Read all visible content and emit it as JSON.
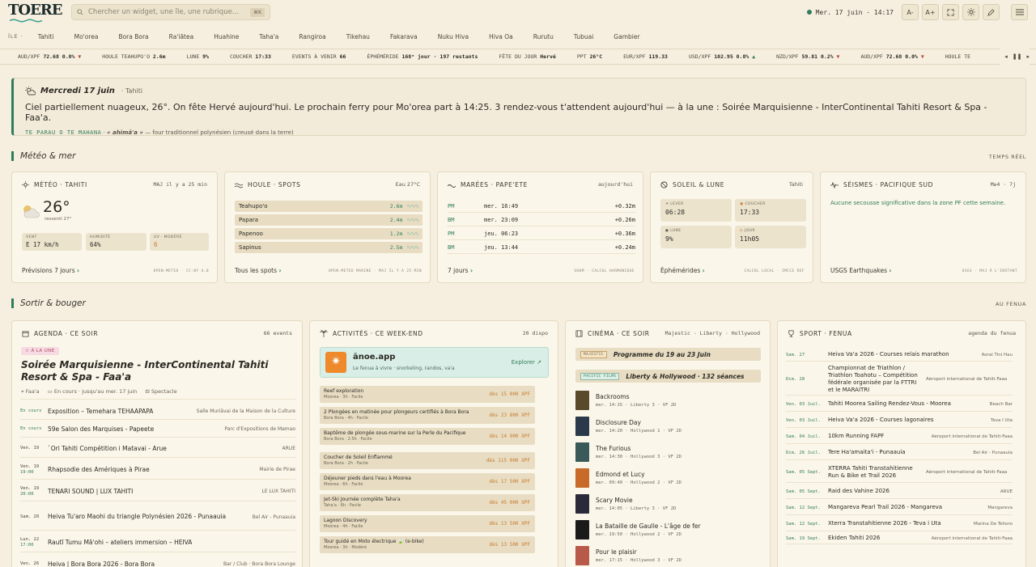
{
  "header": {
    "logo": "TOERE",
    "search_placeholder": "Chercher un widget, une île, une rubrique…",
    "search_kbd": "⌘K",
    "clock": "Mer. 17 juin · 14:17",
    "btn_font_down": "A-",
    "btn_font_up": "A+"
  },
  "islands": {
    "label": "ÎLE ·",
    "items": [
      "Tahiti",
      "Mo'orea",
      "Bora Bora",
      "Ra'iātea",
      "Huahine",
      "Taha'a",
      "Rangiroa",
      "Tikehau",
      "Fakarava",
      "Nuku Hiva",
      "Hiva Oa",
      "Rurutu",
      "Tubuai",
      "Gambier"
    ]
  },
  "ticker": [
    {
      "k": "AUD/XPF",
      "v": "72.68",
      "c": "0.0%",
      "dir": "down"
    },
    {
      "k": "HOULE TEAHUPO'O",
      "v": "2.6m"
    },
    {
      "k": "LUNE",
      "v": "9%"
    },
    {
      "k": "COUCHER",
      "v": "17:33"
    },
    {
      "k": "EVENTS À VENIR",
      "v": "66"
    },
    {
      "k": "ÉPHÉMÉRIDE",
      "v": "168ᵉ jour · 197 restants"
    },
    {
      "k": "FÊTE DU JOUR",
      "v": "Hervé"
    },
    {
      "k": "PPT",
      "v": "26°C"
    },
    {
      "k": "EUR/XPF",
      "v": "119.33"
    },
    {
      "k": "USD/XPF",
      "v": "102.95",
      "c": "0.8%",
      "dir": "up"
    },
    {
      "k": "NZD/XPF",
      "v": "59.81",
      "c": "0.2%",
      "dir": "down"
    },
    {
      "k": "AUD/XPF",
      "v": "72.68",
      "c": "0.0%",
      "dir": "down"
    },
    {
      "k": "HOULE TE",
      "v": ""
    }
  ],
  "hero": {
    "date": "Mercredi 17 juin",
    "loc": "Tahiti",
    "message": "Ciel partiellement nuageux, 26°. On fête Hervé aujourd'hui. Le prochain ferry pour Mo'orea part à 14:25. 3 rendez-vous t'attendent aujourd'hui — à la une : Soirée Marquisienne - InterContinental Tahiti Resort & Spa - Faa'a.",
    "sub_label": "TE PARAU O TE MAHANA",
    "sub_word": "« ahimā'a »",
    "sub_rest": "— four traditionnel polynésien (creusé dans la terre)"
  },
  "section1": {
    "title": "Météo & mer",
    "right": "TEMPS RÉEL"
  },
  "meteo": {
    "title": "MÉTÉO · TAHITI",
    "maj": "MAJ il y a 25 min",
    "temp": "26°",
    "ressenti": "ressenti 27°",
    "vent_l": "VENT",
    "vent_v": "E 17 km/h",
    "hum_l": "HUMIDITÉ",
    "hum_v": "64%",
    "uv_l": "UV · MODÉRÉ",
    "uv_v": "6",
    "foot": "Prévisions 7 jours",
    "src": "OPEN-METEO · CC-BY 4.0"
  },
  "houle": {
    "title": "HOULE · SPOTS",
    "eau": "Eau 27°C",
    "spots": [
      {
        "n": "Teahupo'o",
        "h": "2.6m"
      },
      {
        "n": "Papara",
        "h": "2.4m"
      },
      {
        "n": "Papenoo",
        "h": "1.2m"
      },
      {
        "n": "Sapinus",
        "h": "2.5m"
      }
    ],
    "foot": "Tous les spots",
    "src": "OPEN-METEO MARINE · MAJ IL Y A 25 MIN"
  },
  "marees": {
    "title": "MARÉES · PAPE'ETE",
    "right": "aujourd'hui",
    "rows": [
      {
        "k": "PM",
        "t": "mer. 16:49",
        "d": "+0.32m"
      },
      {
        "k": "BM",
        "t": "mer. 23:09",
        "d": "+0.26m"
      },
      {
        "k": "PM",
        "t": "jeu. 06:23",
        "d": "+0.36m"
      },
      {
        "k": "BM",
        "t": "jeu. 13:44",
        "d": "+0.24m"
      }
    ],
    "foot": "7 jours",
    "src": "SHOM · CALCUL HARMONIQUE"
  },
  "soleil": {
    "title": "SOLEIL & LUNE",
    "right": "Tahiti",
    "lever_l": "☀ LEVER",
    "lever_v": "06:28",
    "coucher_l": "COUCHER",
    "coucher_v": "17:33",
    "lune_l": "LUNE",
    "lune_v": "9%",
    "jour_l": "JOUR",
    "jour_v": "11h05",
    "foot": "Éphémérides",
    "src": "CALCUL LOCAL · IMCCE REF"
  },
  "seismes": {
    "title": "SÉISMES · PACIFIQUE SUD",
    "right": "M≥4 · 7j",
    "msg": "Aucune secousse significative dans la zone PF cette semaine.",
    "foot": "USGS Earthquakes",
    "src": "USGS · MAJ À L'INSTANT"
  },
  "section2": {
    "title": "Sortir & bouger",
    "right": "AU FENUA"
  },
  "agenda": {
    "title": "AGENDA · CE SOIR",
    "count": "66 events",
    "badge": "À LA UNE",
    "feat_title": "Soirée Marquisienne - InterContinental Tahiti Resort & Spa - Faa'a",
    "feat_loc": "Faa'a",
    "feat_when": "En cours · jusqu'au mer. 17 juin",
    "feat_type": "Spectacle",
    "rows": [
      {
        "d1": "En cours",
        "d2": "",
        "t": "Exposition – Temehara TEHAAPAPA",
        "p": "Salle Muriāvai de la Maison de la Culture",
        "enc": true
      },
      {
        "d1": "En cours",
        "d2": "",
        "t": "59e Salon des Marquises - Papeete",
        "p": "Parc d'Expositions de Mamao",
        "enc": true
      },
      {
        "d1": "Ven. 19",
        "d2": "",
        "t": "`Ori Tahiti Compétition i Matavai - Arue",
        "p": "ARUE"
      },
      {
        "d1": "Ven. 19",
        "d2": "19:00",
        "t": "Rhapsodie des Amériques à Pirae",
        "p": "Mairie de Pirae"
      },
      {
        "d1": "Ven. 19",
        "d2": "20:00",
        "t": "TENARI SOUND | LUX TAHITI",
        "p": "LE LUX TAHITI"
      },
      {
        "d1": "Sam. 20",
        "d2": "",
        "t": "Heiva Tu'aro Maohi du triangle Polynésien 2026 - Punaauia",
        "p": "Bel Air - Punaauia"
      },
      {
        "d1": "Lun. 22",
        "d2": "17:00",
        "t": "Rautī Tumu Mā'ohi – ateliers immersion – HEIVA",
        "p": ""
      },
      {
        "d1": "Ven. 26",
        "d2": "",
        "t": "Heiva | Bora Bora 2026 - Bora Bora",
        "p": "Bar / Club · Bora Bora Lounge"
      }
    ]
  },
  "activites": {
    "title": "ACTIVITÉS · CE WEEK-END",
    "count": "20 dispo",
    "banner_title": "ānoe.app",
    "banner_sub": "Le fenua à vivre · snorkeling, randos, va'a",
    "banner_btn": "Explorer ↗",
    "rows": [
      {
        "n": "Reef exploration",
        "s": "Moorea · 3h · Facile",
        "p": "dès 15 000 XPF"
      },
      {
        "n": "2 Plongées en matinée pour plongeurs certifiés à Bora Bora",
        "s": "Bora Bora · 4h · Facile",
        "p": "dès 23 800 XPF"
      },
      {
        "n": "Baptême de plongée sous-marine sur la Perle du Pacifique",
        "s": "Bora Bora · 2.5h · Facile",
        "p": "dès 14 900 XPF"
      },
      {
        "n": "Coucher de Soleil Enflammé",
        "s": "Bora Bora · 2h · Facile",
        "p": "dès 115 000 XPF"
      },
      {
        "n": "Déjeuner pieds dans l'eau à Moorea",
        "s": "Moorea · 6h · Facile",
        "p": "dès 17 500 XPF"
      },
      {
        "n": "Jet-Ski Journée complète Taha'a",
        "s": "Taha'a · 6h · Facile",
        "p": "dès 45 000 XPF"
      },
      {
        "n": "Lagoon Discovery",
        "s": "Moorea · 4h · Facile",
        "p": "dès 13 500 XPF"
      },
      {
        "n": "Tour guidé en Moto électrique 🍃 (e-bike)",
        "s": "Moorea · 3h · Modéré",
        "p": "dès 13 500 XPF"
      }
    ]
  },
  "cinema": {
    "title": "CINÉMA · CE SOIR",
    "venues": "Majestic · Liberty · Hollywood",
    "p1_tag": "MAJESTIC",
    "p1": "Programme du 19 au 23 Juin",
    "p2_tag": "PACIFIC FILMS",
    "p2": "Liberty & Hollywood · 132 séances",
    "films": [
      {
        "t": "Backrooms",
        "s": "mer. 14:15 · Liberty 3 · VF 2D",
        "c": "#5a4a2c"
      },
      {
        "t": "Disclosure Day",
        "s": "mer. 14:20 · Hollywood 1 · VF 2D",
        "c": "#2a3a4a"
      },
      {
        "t": "The Furious",
        "s": "mer. 14:30 · Hollywood 3 · VF 2D",
        "c": "#3a5a5a"
      },
      {
        "t": "Edmond et Lucy",
        "s": "mer. 09:40 · Hollywood 2 · VF 2D",
        "c": "#c86a2a"
      },
      {
        "t": "Scary Movie",
        "s": "mer. 14:05 · Liberty 3 · VF 2D",
        "c": "#2a2a3a"
      },
      {
        "t": "La Bataille de Gaulle - L'âge de fer",
        "s": "mer. 19:50 · Hollywood 2 · VF 2D",
        "c": "#1a1a1a"
      },
      {
        "t": "Pour le plaisir",
        "s": "mer. 17:15 · Hollywood 3 · VF 2D",
        "c": "#b85a4a"
      }
    ]
  },
  "sport": {
    "title": "SPORT · FENUA",
    "right": "agenda du fenua",
    "rows": [
      {
        "d": "Sam. 27",
        "t": "Heiva Va'a 2026 - Courses relais marathon",
        "p": "Aorai Tini Hau"
      },
      {
        "d": "Dim. 28",
        "t": "Championnat de Triathlon / Triathlon Toahotu – Compétition fédérale organisée par la FTTRI et le MARAITRI",
        "p": "Aéroport international de Tahiti-Faaa"
      },
      {
        "d": "Ven. 03 Juil.",
        "t": "Tahiti Moorea Sailing Rendez-Vous - Moorea",
        "p": "Beach Bar"
      },
      {
        "d": "Ven. 03 Juil.",
        "t": "Heiva Va'a 2026 - Courses lagonaires",
        "p": "Teva I Uta"
      },
      {
        "d": "Sam. 04 Juil.",
        "t": "10km Running FAPF",
        "p": "Aéroport international de Tahiti-Faaa"
      },
      {
        "d": "Dim. 26 Juil.",
        "t": "Tere Ha'amaita'i - Punaauia",
        "p": "Bel Air - Punaauia"
      },
      {
        "d": "Sam. 05 Sept.",
        "t": "XTERRA Tahiti Transtahitienne Run & Bike et Trail 2026",
        "p": "Aéroport international de Tahiti-Faaa"
      },
      {
        "d": "Sam. 05 Sept.",
        "t": "Raid des Vahine 2026",
        "p": "ARUE"
      },
      {
        "d": "Sam. 12 Sept.",
        "t": "Mangareva Pearl Trail 2026 - Mangareva",
        "p": "Mangareva"
      },
      {
        "d": "Sam. 12 Sept.",
        "t": "Xterra Transtahitienne 2026 - Teva i Uta",
        "p": "Marina De Tehoro"
      },
      {
        "d": "Sam. 19 Sept.",
        "t": "Ekiden Tahiti 2026",
        "p": "Aéroport international de Tahiti-Faaa"
      }
    ]
  }
}
